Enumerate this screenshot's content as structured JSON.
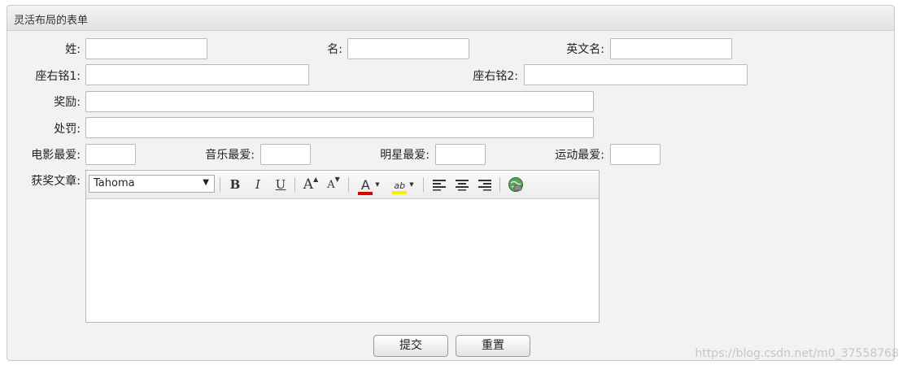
{
  "panel": {
    "title": "灵活布局的表单"
  },
  "form": {
    "surname_label": "姓:",
    "given_name_label": "名:",
    "english_name_label": "英文名:",
    "motto1_label": "座右铭1:",
    "motto2_label": "座右铭2:",
    "reward_label": "奖励:",
    "punishment_label": "处罚:",
    "fav_movie_label": "电影最爱:",
    "fav_music_label": "音乐最爱:",
    "fav_star_label": "明星最爱:",
    "fav_sport_label": "运动最爱:",
    "article_label": "获奖文章:"
  },
  "editor": {
    "font_value": "Tahoma",
    "bold_glyph": "B",
    "italic_glyph": "I",
    "underline_glyph": "U",
    "grow_glyph": "A",
    "shrink_glyph": "A",
    "fontcolor_glyph": "A",
    "highlight_glyph": "ab",
    "colors": {
      "font_color": "#e00000",
      "highlight_color": "#f7f000"
    }
  },
  "buttons": {
    "submit_label": "提交",
    "reset_label": "重置"
  },
  "watermark": "https://blog.csdn.net/m0_37558768"
}
